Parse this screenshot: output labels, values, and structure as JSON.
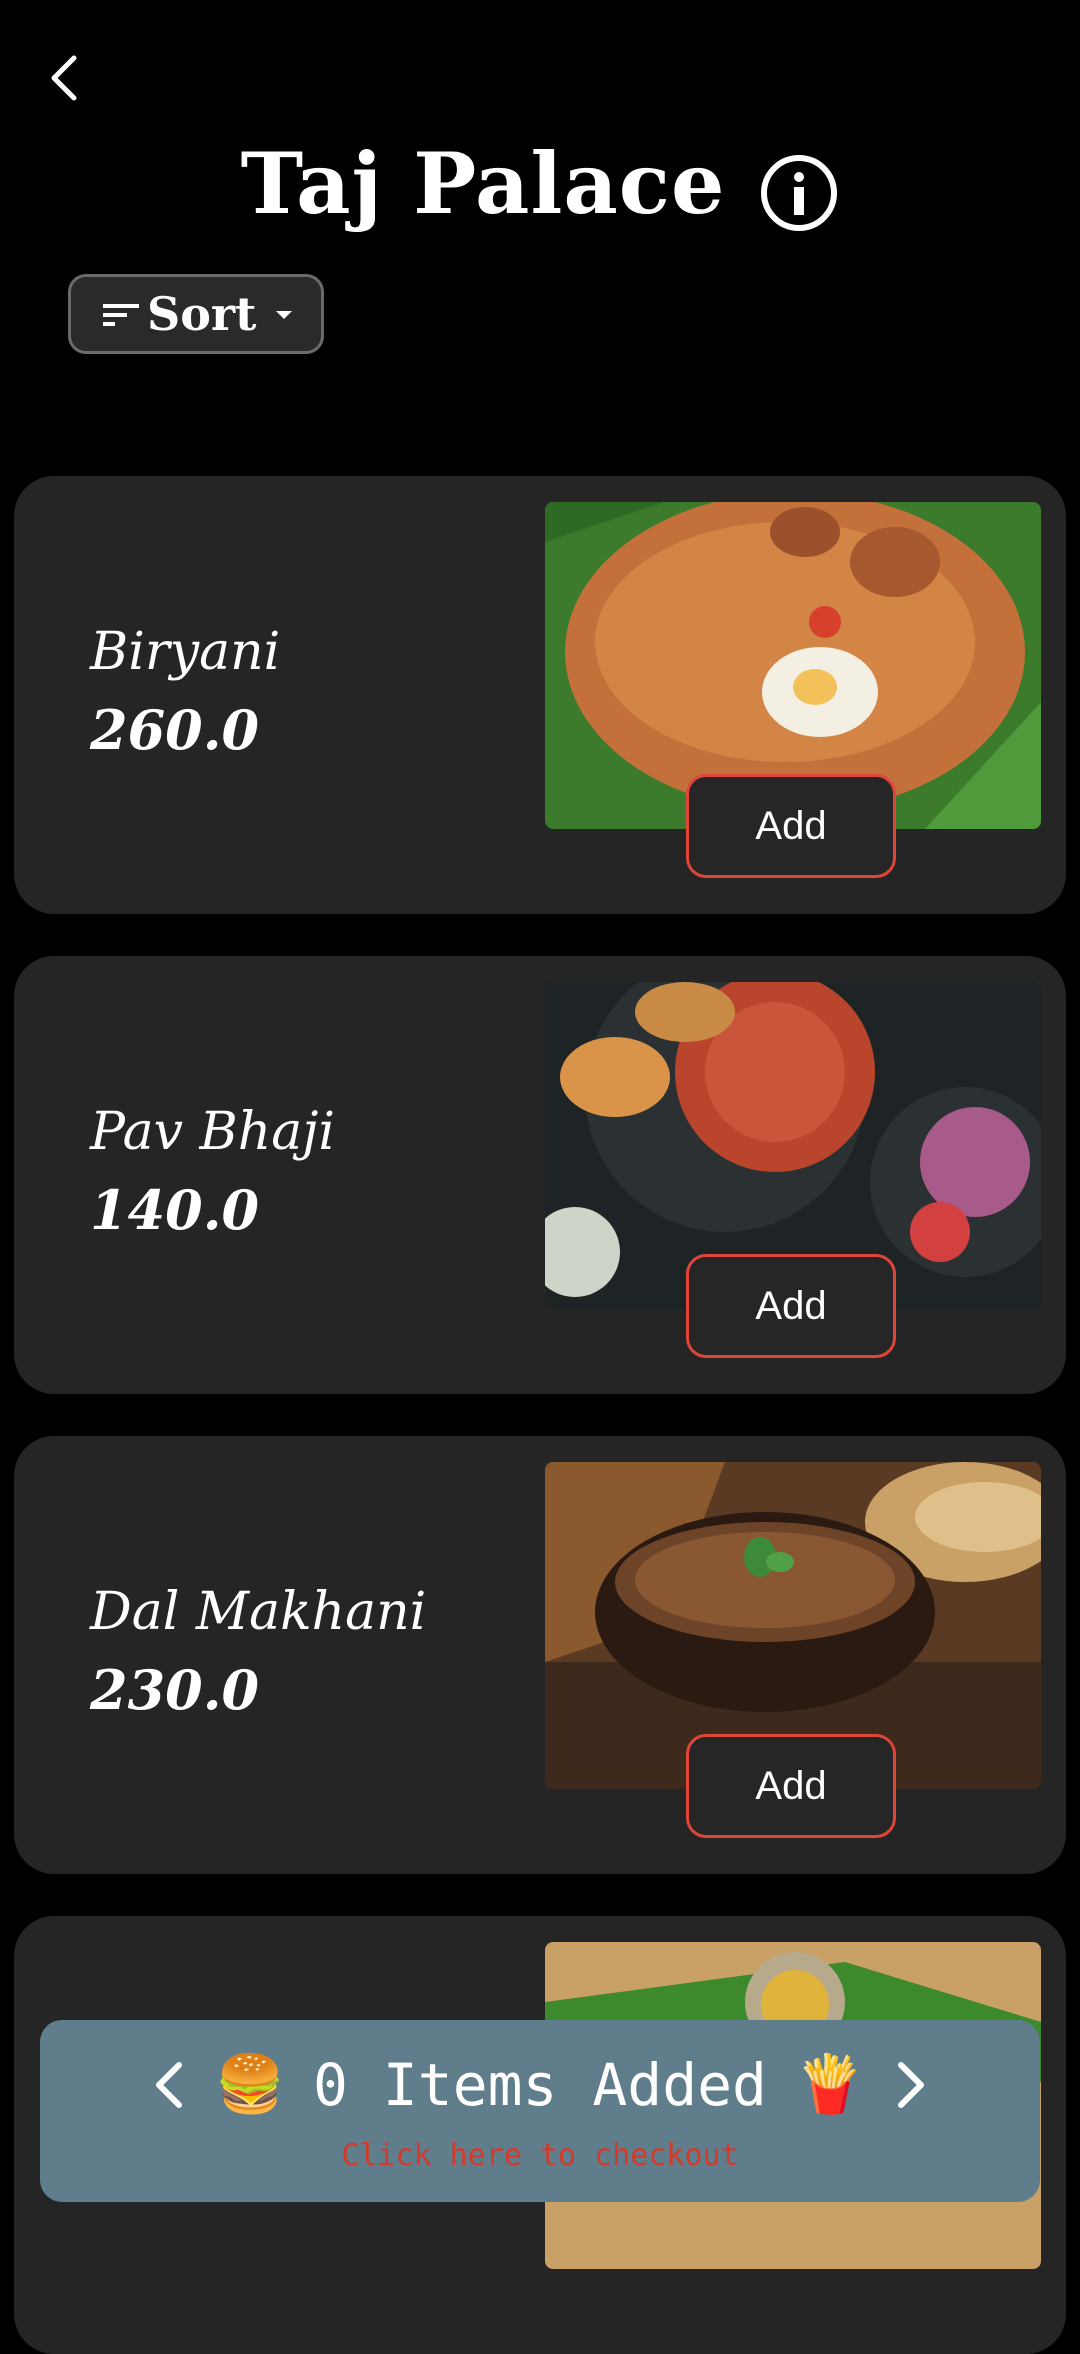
{
  "header": {
    "title": "Taj Palace",
    "back_icon": "back-chevron-icon",
    "info_icon": "info-icon"
  },
  "sort": {
    "label": "Sort",
    "icon": "sort-icon",
    "caret": "caret-down-icon"
  },
  "menu": {
    "items": [
      {
        "name": "Biryani",
        "price": "260.0",
        "add_label": "Add"
      },
      {
        "name": "Pav Bhaji",
        "price": "140.0",
        "add_label": "Add"
      },
      {
        "name": "Dal Makhani",
        "price": "230.0",
        "add_label": "Add"
      },
      {
        "name": "",
        "price": "",
        "add_label": ""
      }
    ]
  },
  "cart": {
    "count_text": "0 Items Added",
    "left_emoji": "🍔",
    "right_emoji": "🍟",
    "checkout_hint": "Click here to checkout"
  },
  "colors": {
    "background": "#000000",
    "card": "#252525",
    "accent_border": "#e0453a",
    "cart_bar": "#5f7d8a",
    "checkout_hint": "#d33a2c"
  }
}
